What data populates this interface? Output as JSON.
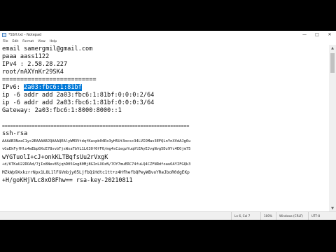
{
  "window": {
    "title": "*SSH.txt - Notepad"
  },
  "menu": [
    "File",
    "Edit",
    "Format",
    "View",
    "Help"
  ],
  "lines": [
    "email samergmil@gmail.com",
    "paaa aass1122",
    "IPv4 : 2.58.28.227",
    "root/nAXYnKr29SK4",
    "==========================",
    "IPv6: 2a03:fbc6:1:81bf",
    "ip -6 addr add 2a03:fbc6:1:81bf:0:0:0:2/64",
    "ip -6 addr add 2a03:fbc6:1:81bf:0:0:0:3/64",
    "Gateway: 2a03:fbc6:1:8000:8000::1",
    "",
    "=====================================================================",
    "ssh-rsa",
    "AAAAB3NzaC1yc2EAAAABJQAAAQEAlyWM3VtdqfKaspb04Rx3yH5Ut3ocsc34LVIOMav3EFQLnYnXVdAJg6u",
    "vGuEkFyfHlo4wEbp0XcE78vvbTjsWsaTbVL1L63Of0fF0/mg4sCiegzYuqVlEAyEJvgNvg5Dz9Yc4EOjm75",
    "wYGTuolI+cJ+onkKLTBqfsUu2rVxgK",
    "+d/6TKaU22ROAd/7jIo8Nev85jqhD05Gng80Mj8GInLXOzN/7OY7muERC74fuLQ4CZFNRdfoauOAYIFGQk3",
    "MZkWp9XxkzrrNpx1L8L1lFGVmbjy05LjfbQiHdtc1tt+z4HfhefbQPeyWBvoYReJboR0dgEKp",
    "+H/goKHjVLc8xO8Fhw== rsa-key-20210811"
  ],
  "selection": {
    "line_prefix": "IPv6: ",
    "selected": "2a03:fbc6:1:81bf"
  },
  "status": {
    "position": "Ln 6, Col 7",
    "zoom": "100%",
    "eol": "Windows (CRLF)",
    "encoding": "UTF-8"
  }
}
